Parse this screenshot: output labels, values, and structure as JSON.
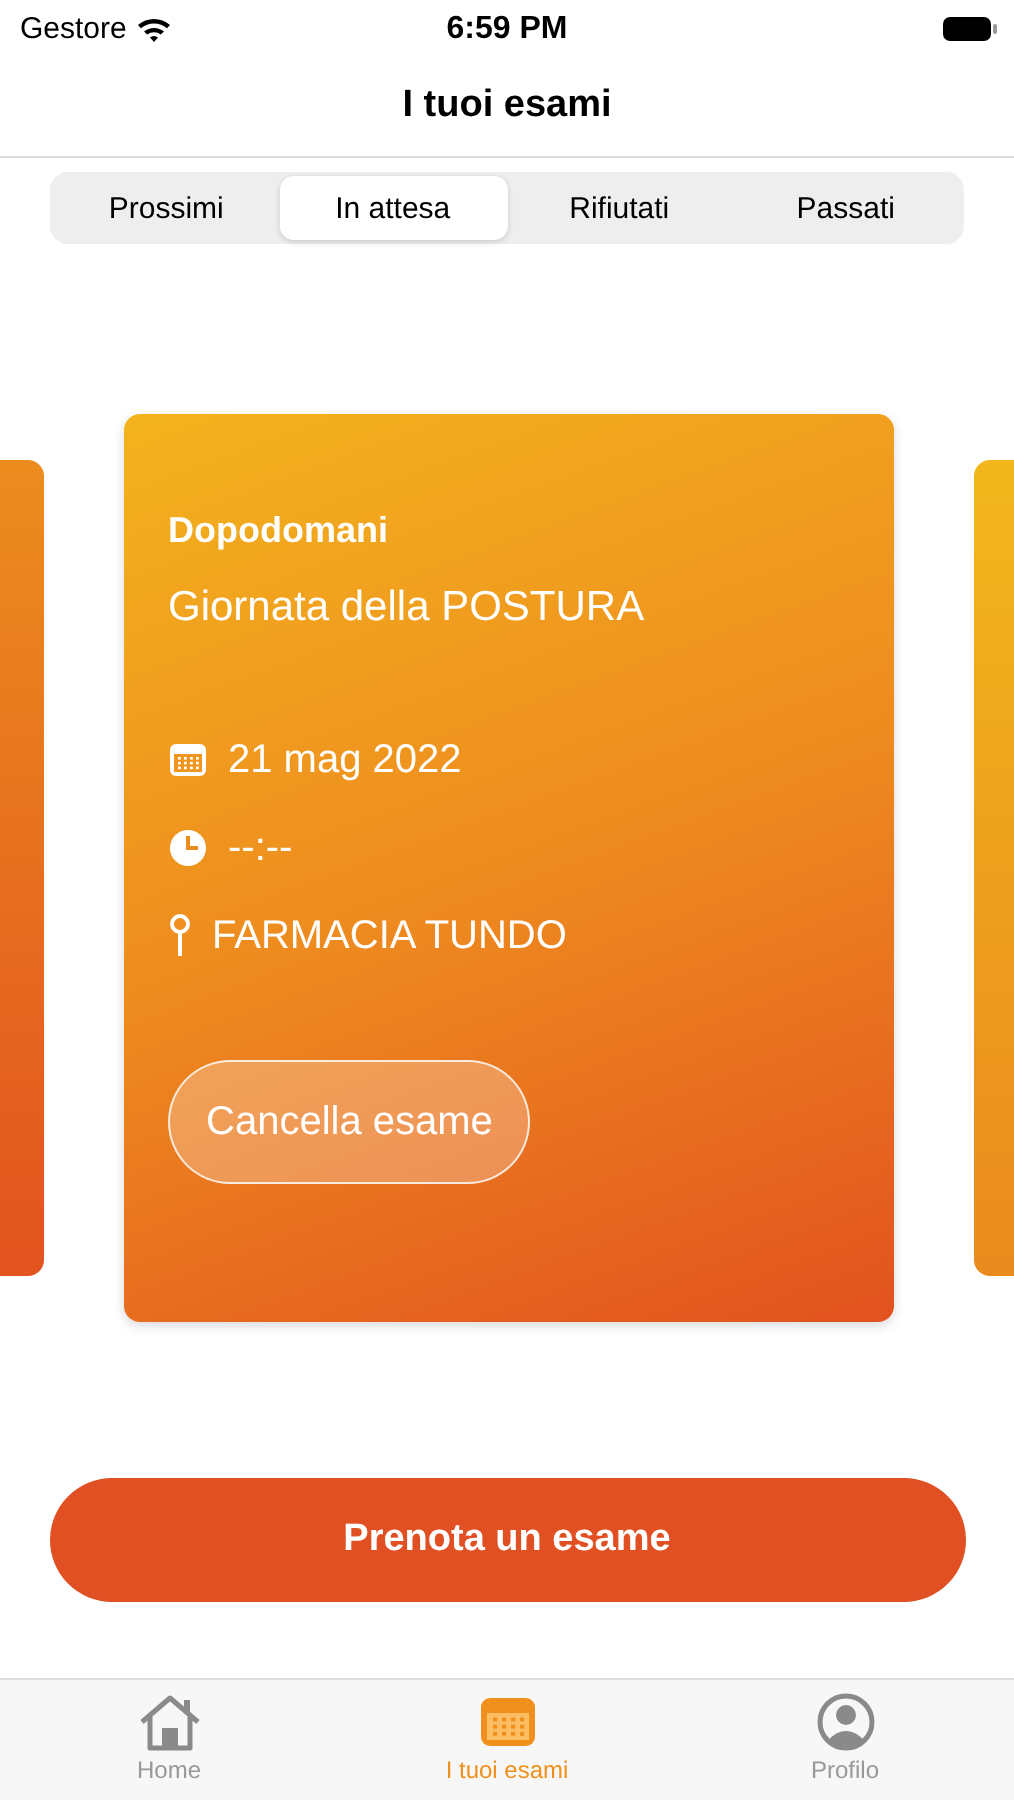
{
  "status_bar": {
    "carrier": "Gestore",
    "time": "6:59 PM"
  },
  "nav": {
    "title": "I tuoi esami"
  },
  "tabs": [
    {
      "label": "Prossimi",
      "selected": false
    },
    {
      "label": "In attesa",
      "selected": true
    },
    {
      "label": "Rifiutati",
      "selected": false
    },
    {
      "label": "Passati",
      "selected": false
    }
  ],
  "card": {
    "when": "Dopodomani",
    "title": "Giornata della POSTURA",
    "details": [
      {
        "kind": "date",
        "text": "21 mag 2022"
      },
      {
        "kind": "time",
        "text": "--:--"
      },
      {
        "kind": "place",
        "text": "FARMACIA TUNDO"
      }
    ],
    "action": "Cancella esame"
  },
  "primary_button": "Prenota un esame",
  "tab_bar": [
    {
      "kind": "home",
      "label": "Home",
      "selected": false
    },
    {
      "kind": "calendar",
      "label": "I tuoi esami",
      "selected": true
    },
    {
      "kind": "profile",
      "label": "Profilo",
      "selected": false
    }
  ]
}
